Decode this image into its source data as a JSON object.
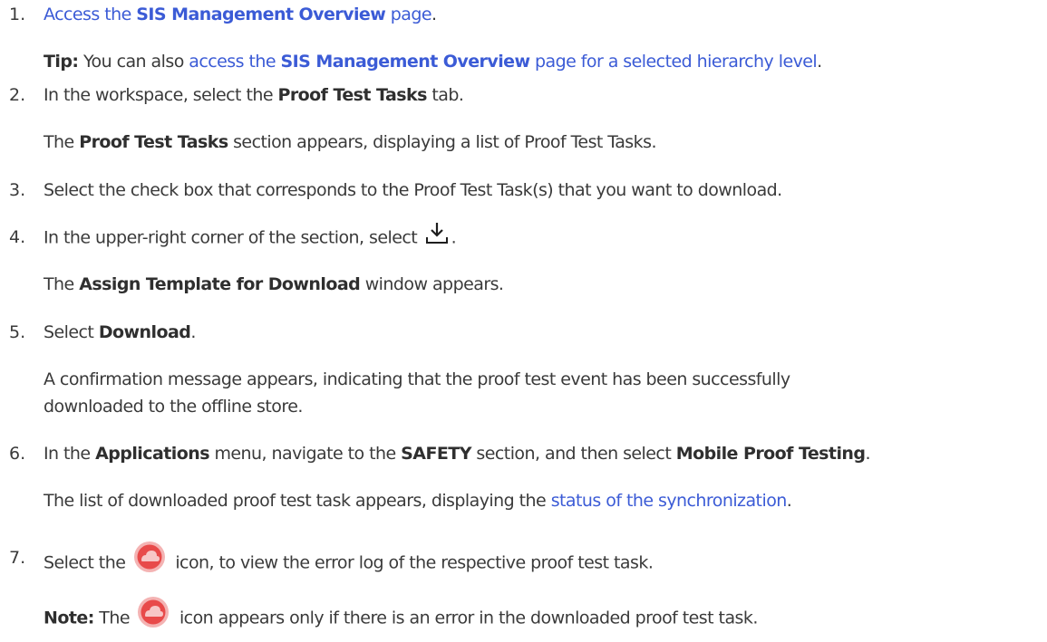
{
  "steps": [
    {
      "number": "1.",
      "prefix_link": "Access the ",
      "link_bold": "SIS Management Overview",
      "link_suffix": " page",
      "after": "."
    },
    {
      "tip_label": "Tip:",
      "tip_text": " You can also ",
      "tip_link_prefix": "access the ",
      "tip_link_bold": "SIS Management Overview",
      "tip_link_suffix": " page for a selected hierarchy level",
      "tip_after": "."
    },
    {
      "number": "2.",
      "pre": "In the workspace, select the ",
      "bold": "Proof Test Tasks",
      "post": " tab."
    },
    {
      "result_bold": "Proof Test Tasks",
      "result_post": " section appears, displaying a list of Proof Test Tasks.",
      "result_pre": "The "
    },
    {
      "number": "3.",
      "text": "Select the check box that corresponds to the Proof Test Task(s) that you want to download."
    },
    {
      "number": "4.",
      "text": "In the upper-right corner of the section, select",
      "after": "."
    },
    {
      "result_pre": "The ",
      "result_bold": "Assign Template for Download",
      "result_post": " window appears."
    },
    {
      "number": "5.",
      "pre": "Select ",
      "bold": "Download",
      "post": "."
    },
    {
      "line1": "A confirmation message appears, indicating that the proof test event has been successfully",
      "line2": "downloaded to the offline store."
    },
    {
      "number": "6.",
      "pre": "In the ",
      "bold1": "Applications",
      "mid": " menu, navigate to the ",
      "bold2": "SAFETY",
      "mid2": " section, and then select ",
      "bold3": "Mobile Proof Testing",
      "post": "."
    },
    {
      "pre": "The list of downloaded proof test task appears, displaying the ",
      "link": "status of the synchronization",
      "post": "."
    },
    {
      "number": "7.",
      "pre": "Select the ",
      "post": " icon, to view the error log of the respective proof test task."
    },
    {
      "note_label": "Note:",
      "pre": " The ",
      "post": " icon appears only if there is an error in the downloaded proof test task."
    }
  ],
  "icons": {
    "download": "download-icon",
    "cloud_error": "cloud-error-icon",
    "download_color": "#1e1e1e",
    "cloud_color": "#e84a4a"
  },
  "colors": {
    "text": "#3a3a3a",
    "link": "#3b5bd6"
  }
}
